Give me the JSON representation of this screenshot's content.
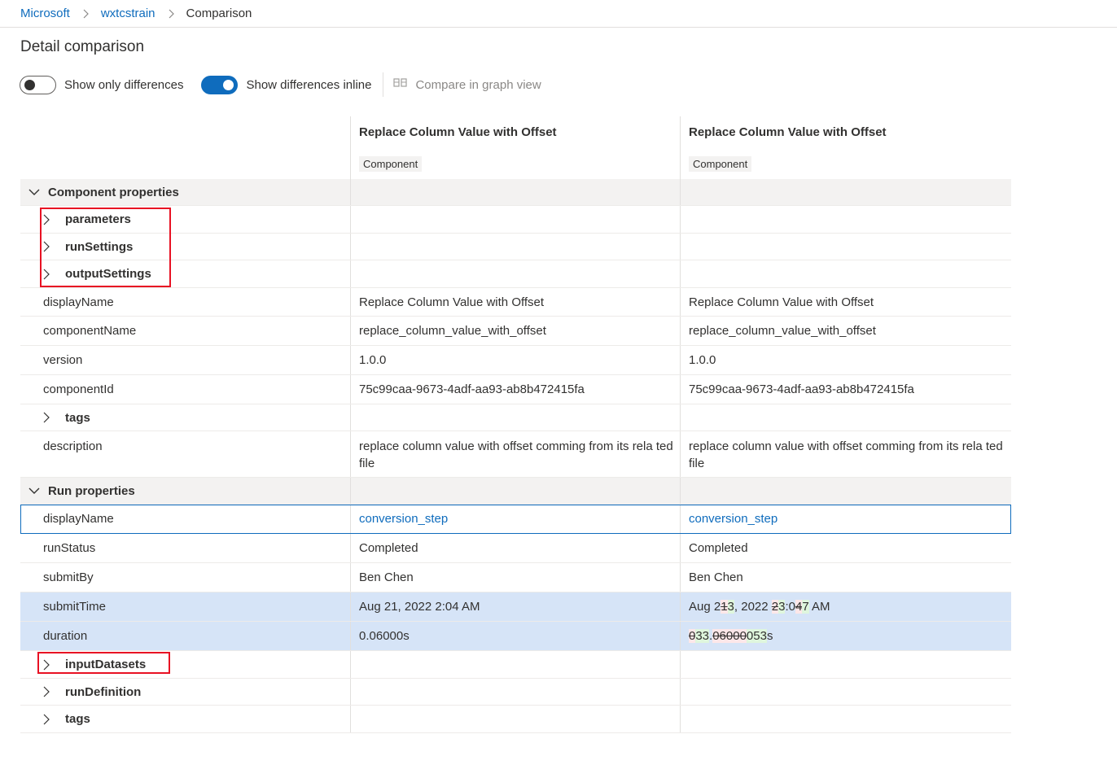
{
  "breadcrumb": {
    "items": [
      "Microsoft",
      "wxtcstrain"
    ],
    "current": "Comparison"
  },
  "page_title": "Detail comparison",
  "toolbar": {
    "show_only_differences": {
      "label": "Show only differences",
      "on": false
    },
    "show_differences_inline": {
      "label": "Show differences inline",
      "on": true
    },
    "compare_graph": "Compare in graph view"
  },
  "columns": [
    {
      "title": "Replace Column Value with Offset",
      "badge": "Component"
    },
    {
      "title": "Replace Column Value with Offset",
      "badge": "Component"
    }
  ],
  "component_section": {
    "label": "Component properties",
    "expandables": [
      "parameters",
      "runSettings",
      "outputSettings"
    ],
    "displayName": {
      "label": "displayName",
      "left": "Replace Column Value with Offset",
      "right": "Replace Column Value with Offset"
    },
    "componentName": {
      "label": "componentName",
      "left": "replace_column_value_with_offset",
      "right": "replace_column_value_with_offset"
    },
    "version": {
      "label": "version",
      "left": "1.0.0",
      "right": "1.0.0"
    },
    "componentId": {
      "label": "componentId",
      "left": "75c99caa-9673-4adf-aa93-ab8b472415fa",
      "right": "75c99caa-9673-4adf-aa93-ab8b472415fa"
    },
    "tags": "tags",
    "description": {
      "label": "description",
      "left": "replace column value with offset comming from its rela ted file",
      "right": "replace column value with offset comming from its rela ted file"
    }
  },
  "run_section": {
    "label": "Run properties",
    "displayName": {
      "label": "displayName",
      "left": "conversion_step",
      "right": "conversion_step"
    },
    "runStatus": {
      "label": "runStatus",
      "left": "Completed",
      "right": "Completed"
    },
    "submitBy": {
      "label": "submitBy",
      "left": "Ben Chen",
      "right": "Ben Chen"
    },
    "submitTime": {
      "label": "submitTime",
      "left": "Aug 21, 2022 2:04 AM",
      "right_parts": {
        "a": "Aug 2",
        "del1": "1",
        "ins1": "3",
        "b": ", 2022 ",
        "del2": "2",
        "ins2": "3",
        "c": ":0",
        "del3": "4",
        "ins3": "7",
        "d": " AM"
      }
    },
    "duration": {
      "label": "duration",
      "left": "0.06000s",
      "right_parts": {
        "del1": "0",
        "ins1": "33",
        "a": ".",
        "del2": "06000",
        "ins2": "053",
        "b": "s"
      }
    },
    "expandables": [
      "inputDatasets",
      "runDefinition",
      "tags"
    ]
  },
  "colors": {
    "accent": "#0f6cbd",
    "diff_row": "#d6e4f7",
    "highlight_box": "#e81123",
    "deleted": "#fde7e9",
    "inserted": "#dff6dd"
  }
}
